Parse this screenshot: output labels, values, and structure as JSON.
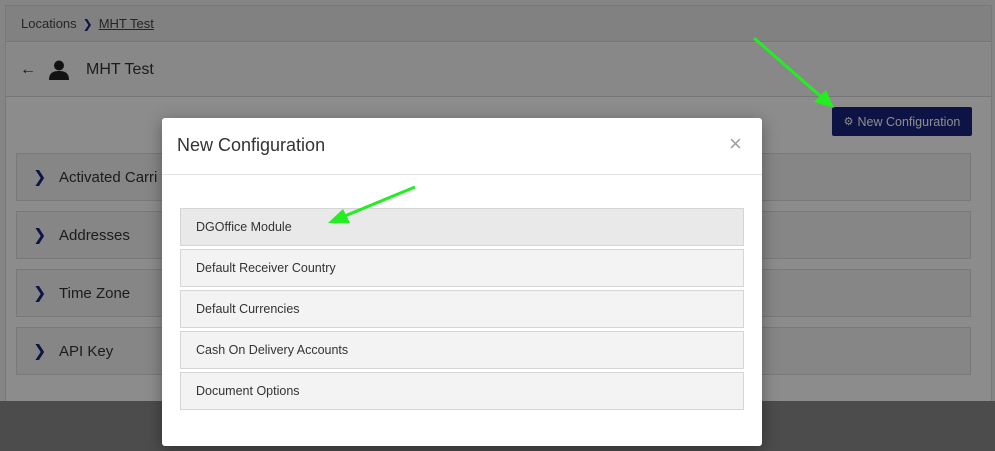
{
  "breadcrumb": {
    "root": "Locations",
    "current": "MHT Test"
  },
  "header": {
    "title": "MHT Test"
  },
  "toolbar": {
    "new_config_label": "New Configuration"
  },
  "panels": [
    {
      "label": "Activated Carri"
    },
    {
      "label": "Addresses"
    },
    {
      "label": "Time Zone"
    },
    {
      "label": "API Key"
    }
  ],
  "modal": {
    "title": "New Configuration",
    "close_glyph": "×",
    "options": [
      {
        "label": "DGOffice Module"
      },
      {
        "label": "Default Receiver Country"
      },
      {
        "label": "Default Currencies"
      },
      {
        "label": "Cash On Delivery Accounts"
      },
      {
        "label": "Document Options"
      }
    ]
  },
  "icons": {
    "back": "arrow-left-icon",
    "user": "person-icon",
    "breadcrumb_sep": "chevron-right-icon",
    "panel_expand": "chevron-right-icon",
    "config_button": "gear-icon",
    "close": "close-icon"
  },
  "colors": {
    "accent": "#1a237e",
    "annotation_arrow": "#22ee22"
  }
}
